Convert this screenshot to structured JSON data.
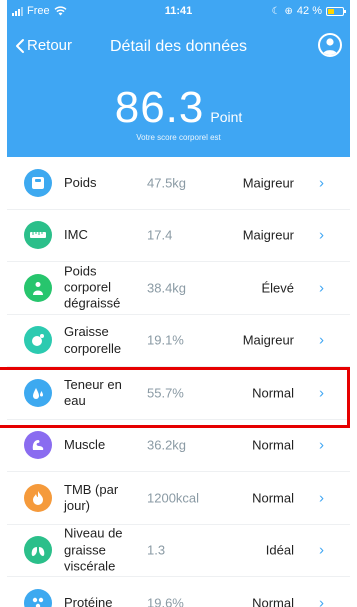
{
  "status_bar": {
    "carrier": "Free",
    "time": "11:41",
    "battery": "42 %"
  },
  "nav": {
    "back_label": "Retour",
    "title": "Détail des données"
  },
  "score": {
    "value": "86.3",
    "unit": "Point",
    "caption": "Votre score corporel est"
  },
  "metrics": [
    {
      "name": "Poids",
      "value": "47.5kg",
      "status": "Maigreur",
      "icon": "scale-icon",
      "color": "#3da9f0"
    },
    {
      "name": "IMC",
      "value": "17.4",
      "status": "Maigreur",
      "icon": "ruler-icon",
      "color": "#2bbf8a"
    },
    {
      "name": "Poids corporel dégraissé",
      "value": "38.4kg",
      "status": "Élevé",
      "icon": "body-icon",
      "color": "#27c56d"
    },
    {
      "name": "Graisse corporelle",
      "value": "19.1%",
      "status": "Maigreur",
      "icon": "fat-icon",
      "color": "#2ccab0"
    },
    {
      "name": "Teneur en eau",
      "value": "55.7%",
      "status": "Normal",
      "icon": "water-drop-icon",
      "color": "#3da9f0"
    },
    {
      "name": "Muscle",
      "value": "36.2kg",
      "status": "Normal",
      "icon": "muscle-icon",
      "color": "#8a6cf0"
    },
    {
      "name": "TMB (par jour)",
      "value": "1200kcal",
      "status": "Normal",
      "icon": "flame-icon",
      "color": "#f59a3b"
    },
    {
      "name": "Niveau de graisse viscérale",
      "value": "1.3",
      "status": "Idéal",
      "icon": "lungs-icon",
      "color": "#2bbf8a"
    },
    {
      "name": "Protéine",
      "value": "19.6%",
      "status": "Normal",
      "icon": "protein-icon",
      "color": "#3da9f0"
    }
  ],
  "colors": {
    "header": "#3fa6f3",
    "accent": "#3fa6f3",
    "highlight": "#e60000"
  }
}
